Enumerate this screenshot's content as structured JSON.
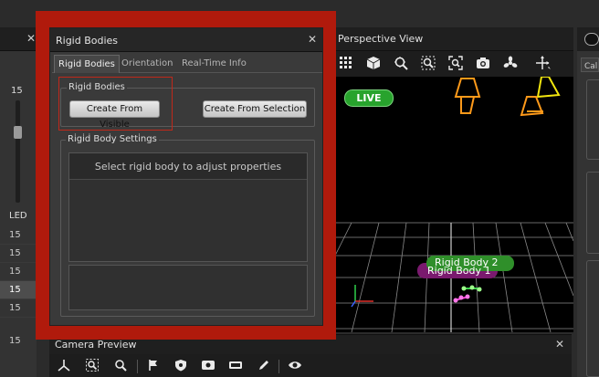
{
  "left_strip": {
    "close_glyph": "✕",
    "slider_value": "15",
    "led_label": "LED",
    "rows": [
      "15",
      "15",
      "15",
      "15",
      "15"
    ],
    "selected_row_index": 3,
    "last_row": "15"
  },
  "dialog": {
    "title": "Rigid Bodies",
    "close_glyph": "✕",
    "tabs": [
      {
        "label": "Rigid Bodies",
        "active": true
      },
      {
        "label": "Orientation",
        "active": false
      },
      {
        "label": "Real-Time Info",
        "active": false
      }
    ],
    "rigid_bodies_group": {
      "label": "Rigid Bodies",
      "create_from_visible": "Create From Visible",
      "create_from_selection": "Create From Selection"
    },
    "settings_group": {
      "label": "Rigid Body Settings",
      "message": "Select rigid body to adjust properties"
    }
  },
  "perspective": {
    "title": "Perspective View",
    "live_label": "LIVE",
    "toolbar_icons": [
      "grid-icon",
      "cube-icon",
      "target-zoom-icon",
      "zoom-region-icon",
      "zoom-fit-icon",
      "camera-icon",
      "fan-icon",
      "move-axes-icon"
    ],
    "rigid_body_labels": [
      "Rigid Body 2",
      "Rigid Body 1"
    ],
    "colors": {
      "live_badge": "#28a32d",
      "rigid_body_2": "#2f8f2a",
      "rigid_body_1": "#7a1a6e",
      "camera_orange": "#ff9a1a",
      "camera_yellow": "#f2e60f"
    }
  },
  "right_panel": {
    "tab_label": "Cal"
  },
  "camera_preview": {
    "title": "Camera Preview",
    "close_glyph": "✕",
    "toolbar_icons": [
      "axes-icon",
      "zoom-region-icon",
      "zoom-icon",
      "flag-icon",
      "shield-icon",
      "shield-alt-icon",
      "record-icon",
      "rectangle-icon",
      "pencil-icon",
      "eye-icon"
    ]
  }
}
